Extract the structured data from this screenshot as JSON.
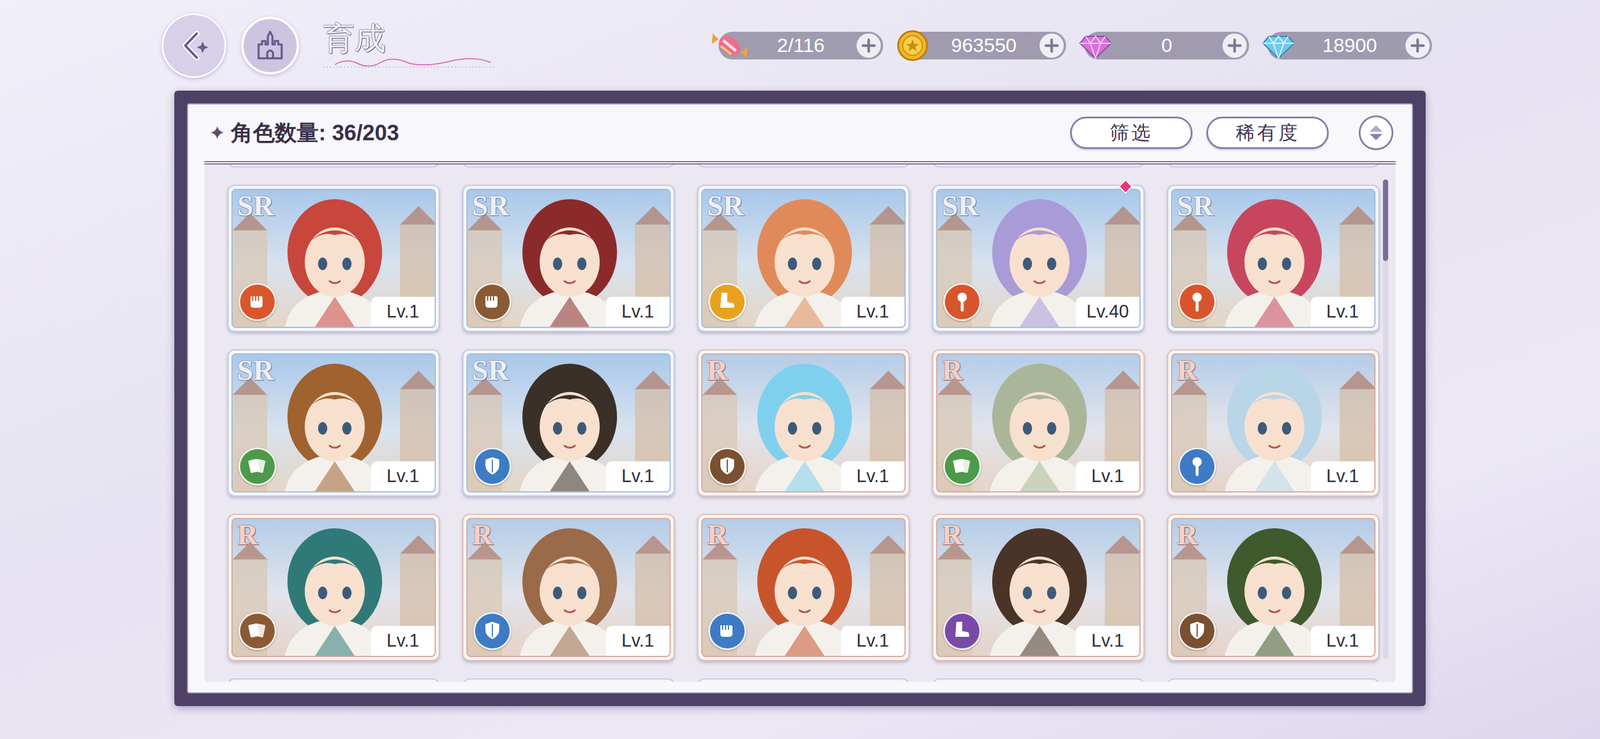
{
  "header": {
    "title": "育成"
  },
  "currencies": [
    {
      "kind": "candy",
      "value": "2/116"
    },
    {
      "kind": "coin",
      "value": "963550"
    },
    {
      "kind": "pink-gem",
      "value": "0"
    },
    {
      "kind": "blue-gem",
      "value": "18900"
    }
  ],
  "roster": {
    "icon": "✦",
    "label": "角色数量: 36/203",
    "buttons": [
      {
        "label": "筛选"
      },
      {
        "label": "稀有度"
      }
    ]
  },
  "scrollbar": {
    "level": 0.17
  },
  "cards": [
    {
      "rarity": "SR",
      "level": "Lv.1",
      "element": "fist",
      "color": "#d9572b",
      "hair": "#c8463c",
      "new": false
    },
    {
      "rarity": "SR",
      "level": "Lv.1",
      "element": "fist",
      "color": "#8a5a34",
      "hair": "#8b2a2a",
      "new": false
    },
    {
      "rarity": "SR",
      "level": "Lv.1",
      "element": "boot",
      "color": "#e8a21f",
      "hair": "#e08a5a",
      "new": false
    },
    {
      "rarity": "SR",
      "level": "Lv.40",
      "element": "mace",
      "color": "#d8552c",
      "hair": "#a99ad8",
      "new": true
    },
    {
      "rarity": "SR",
      "level": "Lv.1",
      "element": "mace",
      "color": "#d8552c",
      "hair": "#c8455e",
      "new": false
    },
    {
      "rarity": "SR",
      "level": "Lv.1",
      "element": "card",
      "color": "#4c9a4a",
      "hair": "#a0622f",
      "new": false
    },
    {
      "rarity": "SR",
      "level": "Lv.1",
      "element": "shield",
      "color": "#3d7bc4",
      "hair": "#3b3028",
      "new": false
    },
    {
      "rarity": "R",
      "level": "Lv.1",
      "element": "shield",
      "color": "#7a5030",
      "hair": "#7fd0ee",
      "new": false
    },
    {
      "rarity": "R",
      "level": "Lv.1",
      "element": "card",
      "color": "#4c9a4a",
      "hair": "#a9b69a",
      "new": false
    },
    {
      "rarity": "R",
      "level": "Lv.1",
      "element": "mace",
      "color": "#3d7bc4",
      "hair": "#b9d5e8",
      "new": false
    },
    {
      "rarity": "R",
      "level": "Lv.1",
      "element": "card",
      "color": "#8a5a34",
      "hair": "#2f7a78",
      "new": false
    },
    {
      "rarity": "R",
      "level": "Lv.1",
      "element": "shield",
      "color": "#3d7bc4",
      "hair": "#9b6a48",
      "new": false
    },
    {
      "rarity": "R",
      "level": "Lv.1",
      "element": "fist",
      "color": "#3d7bc4",
      "hair": "#c8542c",
      "new": false
    },
    {
      "rarity": "R",
      "level": "Lv.1",
      "element": "boot",
      "color": "#7a4aa8",
      "hair": "#4a3428",
      "new": false
    },
    {
      "rarity": "R",
      "level": "Lv.1",
      "element": "shield",
      "color": "#7a5030",
      "hair": "#3f5a2c",
      "new": false
    }
  ]
}
